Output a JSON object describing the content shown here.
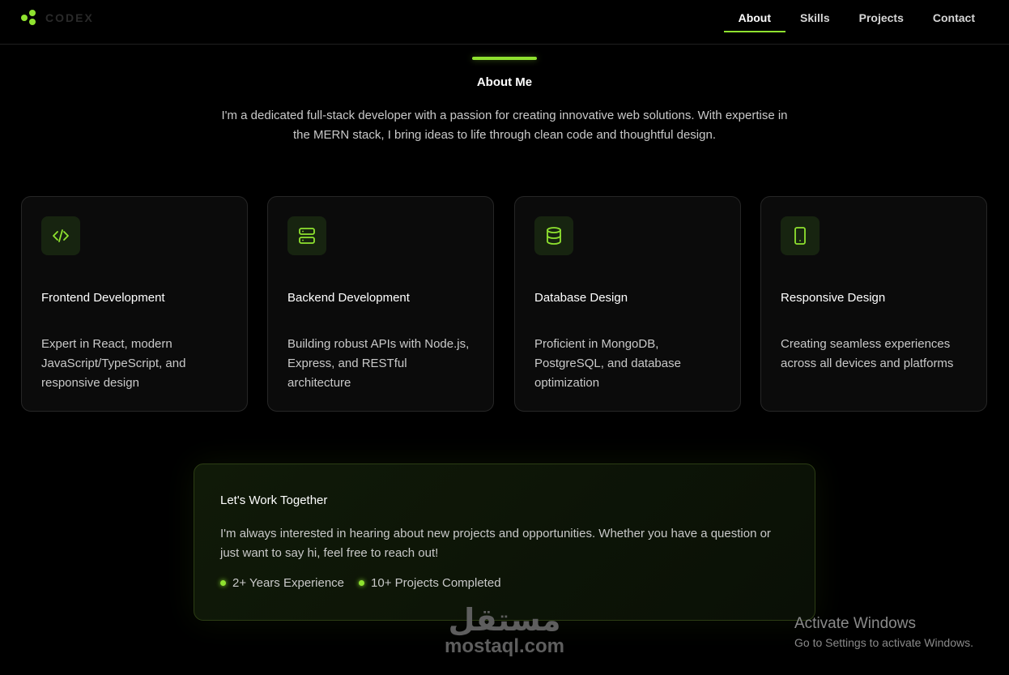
{
  "brand": {
    "name": "CODEX",
    "accent": "#8fe22f"
  },
  "nav": {
    "items": [
      {
        "label": "About",
        "active": true
      },
      {
        "label": "Skills",
        "active": false
      },
      {
        "label": "Projects",
        "active": false
      },
      {
        "label": "Contact",
        "active": false
      }
    ]
  },
  "about": {
    "title": "About Me",
    "intro": "I'm a dedicated full-stack developer with a passion for creating innovative web solutions. With expertise in the MERN stack, I bring ideas to life through clean code and thoughtful design."
  },
  "cards": [
    {
      "icon": "code-icon",
      "title": "Frontend Development",
      "desc": "Expert in React, modern JavaScript/TypeScript, and responsive design"
    },
    {
      "icon": "server-icon",
      "title": "Backend Development",
      "desc": "Building robust APIs with Node.js, Express, and RESTful architecture"
    },
    {
      "icon": "database-icon",
      "title": "Database Design",
      "desc": "Proficient in MongoDB, PostgreSQL, and database optimization"
    },
    {
      "icon": "smartphone-icon",
      "title": "Responsive Design",
      "desc": "Creating seamless experiences across all devices and platforms"
    }
  ],
  "cta": {
    "title": "Let's Work Together",
    "text": "I'm always interested in hearing about new projects and opportunities. Whether you have a question or just want to say hi, feel free to reach out!",
    "stats": [
      "2+ Years Experience",
      "10+ Projects Completed"
    ]
  },
  "watermark": {
    "arabic": "مستقل",
    "latin": "mostaql.com"
  },
  "os_notice": {
    "title": "Activate Windows",
    "subtitle": "Go to Settings to activate Windows."
  }
}
